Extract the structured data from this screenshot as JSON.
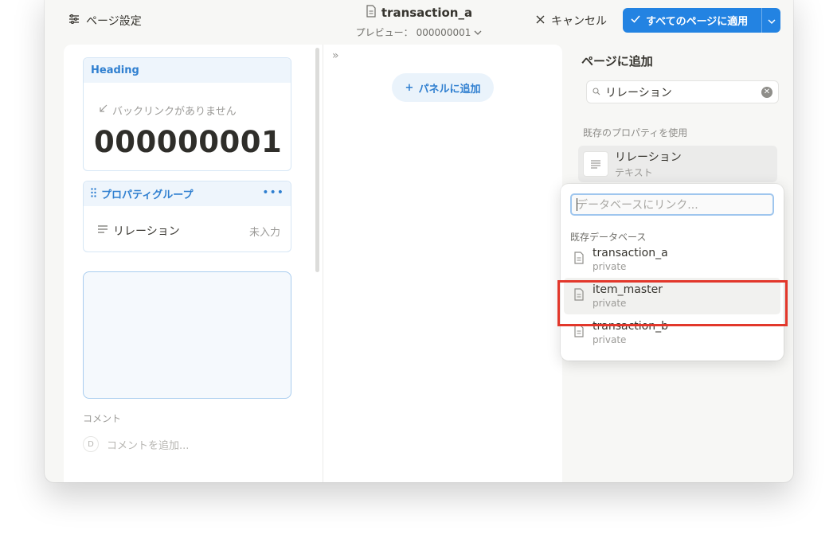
{
  "header": {
    "page_settings_label": "ページ設定",
    "title": "transaction_a",
    "preview_label": "プレビュー：",
    "preview_value": "000000001",
    "cancel_label": "キャンセル",
    "apply_label": "すべてのページに適用"
  },
  "left": {
    "heading_label": "Heading",
    "backlink_text": "バックリンクがありません",
    "record_id": "000000001",
    "group_label": "プロパティグループ",
    "property_name": "リレーション",
    "property_value": "未入力",
    "comment_label": "コメント",
    "comment_avatar": "D",
    "comment_placeholder": "コメントを追加..."
  },
  "center": {
    "add_panel_label": "パネルに追加"
  },
  "sidebar": {
    "title": "ページに追加",
    "search_value": "リレーション",
    "section_label": "既存のプロパティを使用",
    "existing_property": {
      "name": "リレーション",
      "type": "テキスト"
    }
  },
  "dropdown": {
    "placeholder": "データベースにリンク...",
    "section_label": "既存データベース",
    "items": [
      {
        "name": "transaction_a",
        "sub": "private"
      },
      {
        "name": "item_master",
        "sub": "private"
      },
      {
        "name": "transaction_b",
        "sub": "private"
      }
    ]
  },
  "colors": {
    "accent": "#2383e2",
    "highlight_border": "#e2372b"
  }
}
